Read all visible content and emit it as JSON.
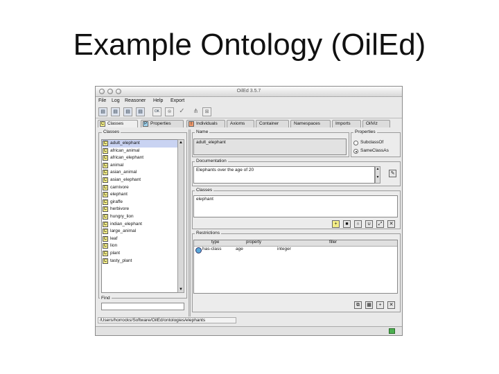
{
  "slide": {
    "title": "Example Ontology (OilEd)"
  },
  "window": {
    "title": "OilEd 3.5.7"
  },
  "menu": [
    "File",
    "Log",
    "Reasoner",
    "Help",
    "Export"
  ],
  "toolbar": {
    "ok_label": "OK"
  },
  "tabs": [
    {
      "label": "Classes",
      "icon": "C"
    },
    {
      "label": "Properties",
      "icon": "P"
    },
    {
      "label": "Individuals",
      "icon": "I"
    },
    {
      "label": "Axioms",
      "icon": ""
    },
    {
      "label": "Container",
      "icon": ""
    },
    {
      "label": "Namespaces",
      "icon": ""
    },
    {
      "label": "Imports",
      "icon": ""
    },
    {
      "label": "OilViz",
      "icon": ""
    }
  ],
  "classes_panel": {
    "legend": "Classes",
    "items": [
      "adult_elephant",
      "african_animal",
      "african_elephant",
      "animal",
      "asian_animal",
      "asian_elephant",
      "carnivore",
      "elephant",
      "giraffe",
      "herbivore",
      "hungry_lion",
      "indian_elephant",
      "large_animal",
      "leaf",
      "lion",
      "plant",
      "tasty_plant"
    ],
    "item_icon": "C",
    "find_label": "Find"
  },
  "name_panel": {
    "legend": "Name",
    "value": "adult_elephant"
  },
  "properties_panel": {
    "legend": "Properties",
    "option1": "SubclassOf",
    "option2": "SameClassAs"
  },
  "documentation_panel": {
    "legend": "Documentation",
    "value": "Elephants over the age of 20"
  },
  "superclasses_panel": {
    "legend": "Classes",
    "value": "elephant"
  },
  "restrictions_panel": {
    "legend": "Restrictions",
    "headers": [
      "type",
      "property",
      "filler"
    ],
    "rows": [
      {
        "type": "has-class",
        "property": "age",
        "filler": "integer"
      }
    ]
  },
  "status": {
    "path": "/Users/horrocks/Software/OilEd/ontologies/elephants"
  }
}
